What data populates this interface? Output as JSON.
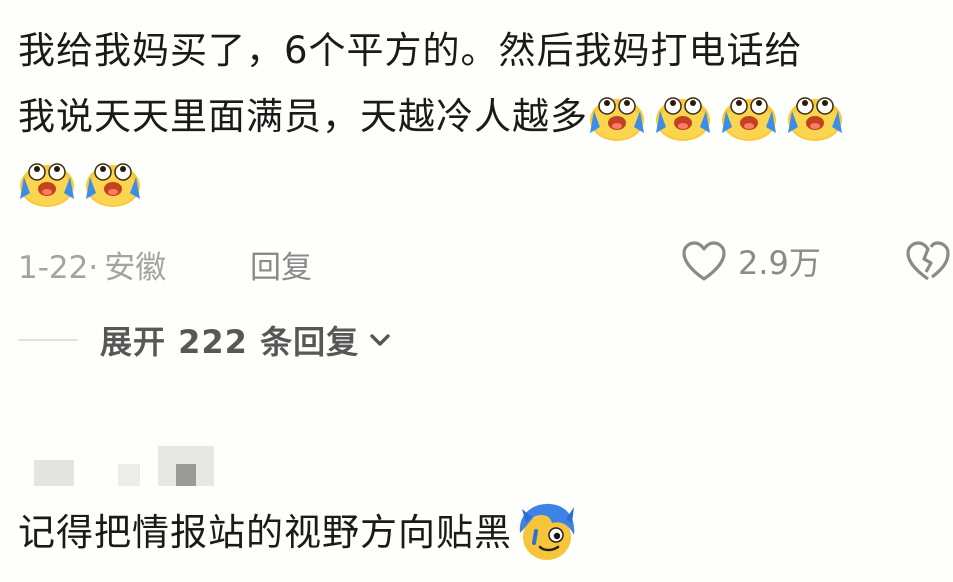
{
  "comment1": {
    "text_line1": "我给我妈买了，6个平方的。然后我妈打电话给",
    "text_line2": "我说天天里面满员，天越冷人越多",
    "emoji_icon": "crying-face-icon",
    "emoji_count": 6,
    "date": "1-22·",
    "location": "安徽",
    "reply_label": "回复",
    "like_count": "2.9万"
  },
  "expand": {
    "label": "展开 222 条回复"
  },
  "comment2": {
    "text": "记得把情报站的视野方向贴黑",
    "sticker_icon": "blue-hair-face-sticker-icon"
  },
  "colors": {
    "background": "#fefefa",
    "text": "#1a1a1a",
    "muted": "#a3a3a3",
    "emoji_yellow": "#f9c93c",
    "tear_blue": "#3a8ee8"
  }
}
